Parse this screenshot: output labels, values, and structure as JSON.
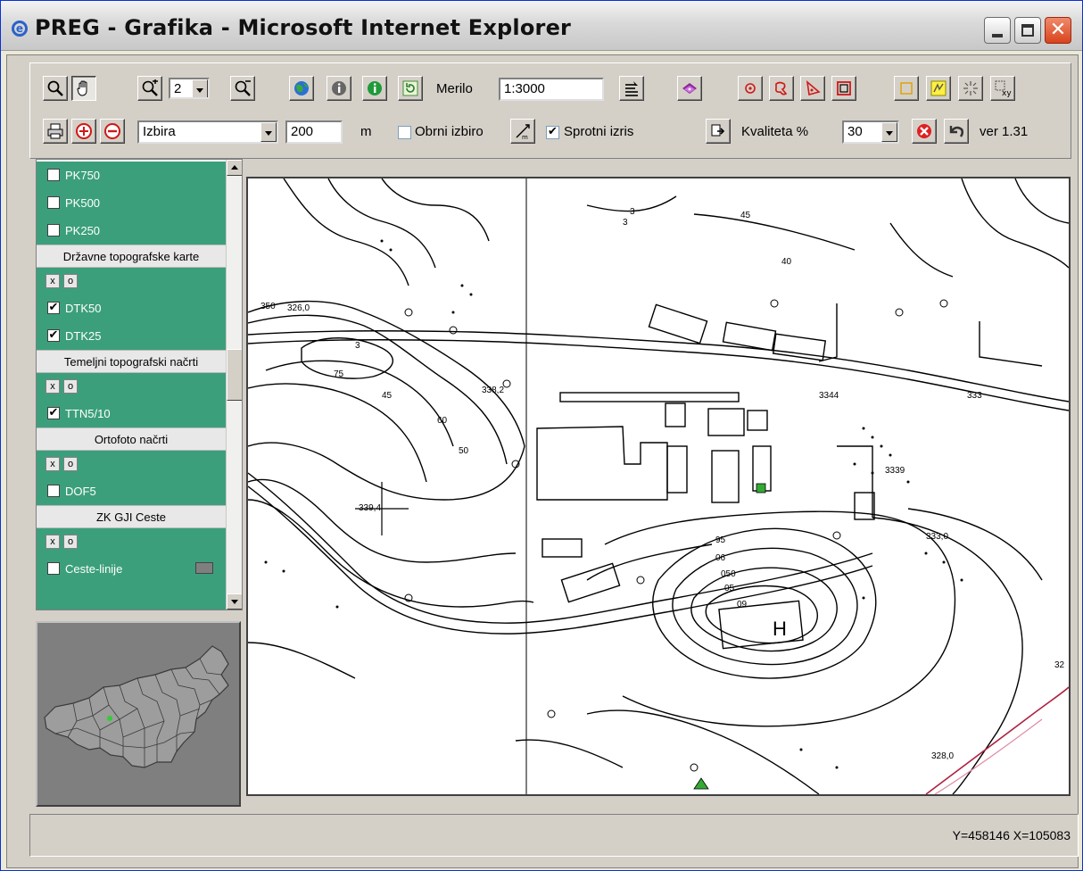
{
  "window": {
    "title": "PREG - Grafika - Microsoft Internet Explorer",
    "ie_icon": "internet-explorer-icon"
  },
  "toolbar": {
    "zoom_level": "2",
    "scale_label": "Merilo",
    "scale_value": "1:3000",
    "selection_mode": "Izbira",
    "distance_value": "200",
    "distance_unit": "m",
    "invert_selection_label": "Obrni izbiro",
    "invert_selection_checked": false,
    "live_draw_label": "Sprotni izris",
    "live_draw_checked": true,
    "quality_label": "Kvaliteta %",
    "quality_value": "30",
    "version": "ver 1.31",
    "icons": [
      "magnifier-icon",
      "hand-pan-icon",
      "zoom-in-icon",
      "zoom-out-icon",
      "globe-icon",
      "info-grey-icon",
      "info-green-icon",
      "refresh-icon",
      "scale-apply-icon",
      "book-icon",
      "point-select-icon",
      "lasso-select-icon",
      "polygon-select-icon",
      "rectangle-select-icon",
      "square-outline-icon",
      "highlight-icon",
      "star-burst-icon",
      "xy-coordinate-icon",
      "print-icon",
      "add-circle-icon",
      "remove-circle-icon",
      "measure-icon",
      "export-icon",
      "stop-icon",
      "undo-icon"
    ]
  },
  "layers": {
    "check_mark": "✔",
    "clear_label": "x",
    "reset_label": "o",
    "items": [
      {
        "type": "layer",
        "label": "PK750",
        "checked": false
      },
      {
        "type": "layer",
        "label": "PK500",
        "checked": false
      },
      {
        "type": "layer",
        "label": "PK250",
        "checked": false
      },
      {
        "type": "group",
        "label": "Državne topografske karte"
      },
      {
        "type": "controls"
      },
      {
        "type": "layer",
        "label": "DTK50",
        "checked": true
      },
      {
        "type": "layer",
        "label": "DTK25",
        "checked": true
      },
      {
        "type": "group",
        "label": "Temeljni topografski načrti"
      },
      {
        "type": "controls"
      },
      {
        "type": "layer",
        "label": "TTN5/10",
        "checked": true
      },
      {
        "type": "group",
        "label": "Ortofoto načrti"
      },
      {
        "type": "controls"
      },
      {
        "type": "layer",
        "label": "DOF5",
        "checked": false
      },
      {
        "type": "group",
        "label": "ZK GJI Ceste"
      },
      {
        "type": "controls"
      },
      {
        "type": "layer",
        "label": "Ceste-linije",
        "checked": false,
        "swatch": "#7f7f7f"
      }
    ]
  },
  "map": {
    "labels": [
      "350",
      "3",
      "75",
      "45",
      "338,2",
      "3",
      "45",
      "40",
      "50",
      "60",
      "3",
      "3344",
      "333",
      "3339",
      "339,4",
      "333,0",
      "328,0",
      "326,0",
      "95",
      "06",
      "050",
      "05",
      "09",
      "32",
      "H"
    ]
  },
  "status": {
    "coords": "Y=458146 X=105083"
  },
  "colors": {
    "layer_bg": "#3c9f7c",
    "chrome_bg": "#d4d0c8",
    "overview_land": "#9d9d9d",
    "overview_marker": "#33cc33"
  }
}
